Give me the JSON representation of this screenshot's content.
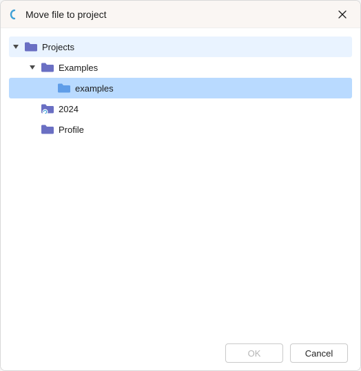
{
  "dialog": {
    "title": "Move file to project"
  },
  "tree": {
    "root": {
      "label": "Projects",
      "children": {
        "examples": {
          "label": "Examples",
          "children": {
            "examples_lc": {
              "label": "examples"
            }
          }
        },
        "y2024": {
          "label": "2024"
        },
        "profile": {
          "label": "Profile"
        }
      }
    }
  },
  "footer": {
    "ok": "OK",
    "cancel": "Cancel"
  },
  "colors": {
    "folder": "#6a6fc3",
    "folder_selected": "#5f9de8",
    "expander": "#4a4a4a"
  }
}
